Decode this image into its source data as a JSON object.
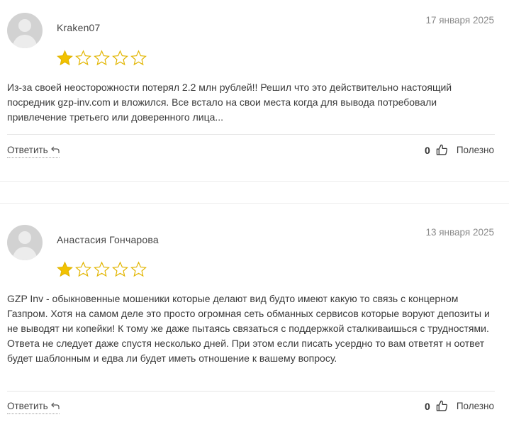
{
  "reviews": [
    {
      "author": "Kraken07",
      "date": "17 января 2025",
      "rating": 1,
      "text": "Из-за своей неосторожности потерял 2.2 млн рублей!! Решил что это действительно настоящий посредник gzp-inv.com и вложился. Все встало на свои места когда для вывода потребовали привлечение третьего или доверенного лица...",
      "reply_label": "Ответить",
      "likes": "0",
      "useful_label": "Полезно"
    },
    {
      "author": "Анастасия Гончарова",
      "date": "13 января 2025",
      "rating": 1,
      "text": "GZP Inv - обыкновенные мошеники которые делают вид будто имеют какую то связь с концерном Газпром. Хотя на самом деле это просто огромная сеть обманных сервисов которые воруют депозиты и не выводят ни копейки! К тому же даже пытаясь связаться с поддержкой сталкиваишься с трудностями. Ответа не следует даже спустя несколько дней. При этом если писать усердно то вам ответят н оответ будет шаблонным и едва ли будет иметь отношение к вашему вопросу.",
      "reply_label": "Ответить",
      "likes": "0",
      "useful_label": "Полезно"
    }
  ],
  "colors": {
    "star_filled": "#f2c200",
    "star_empty": "#e2b500",
    "avatar_bg": "#d2d2d2"
  },
  "icons": {
    "reply": "reply-arrow-icon",
    "like": "thumbs-up-icon",
    "avatar": "user-placeholder-icon",
    "star": "star-icon"
  }
}
